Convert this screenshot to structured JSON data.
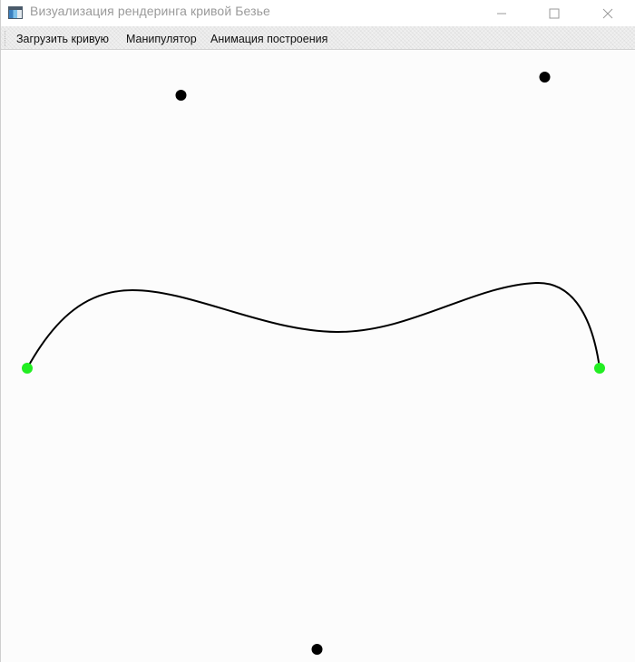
{
  "window": {
    "title": "Визуализация рендеринга кривой Безье",
    "icon": "app-window-icon",
    "controls": [
      "minimize-icon",
      "maximize-icon",
      "close-icon"
    ]
  },
  "menu": {
    "items": [
      {
        "label": "Загрузить кривую"
      },
      {
        "label": "Манипулятор"
      },
      {
        "label": "Анимация построения"
      }
    ]
  },
  "canvas": {
    "curve_color": "#000000",
    "endpoint_color": "#22ee22",
    "control_point_color": "#000000"
  }
}
